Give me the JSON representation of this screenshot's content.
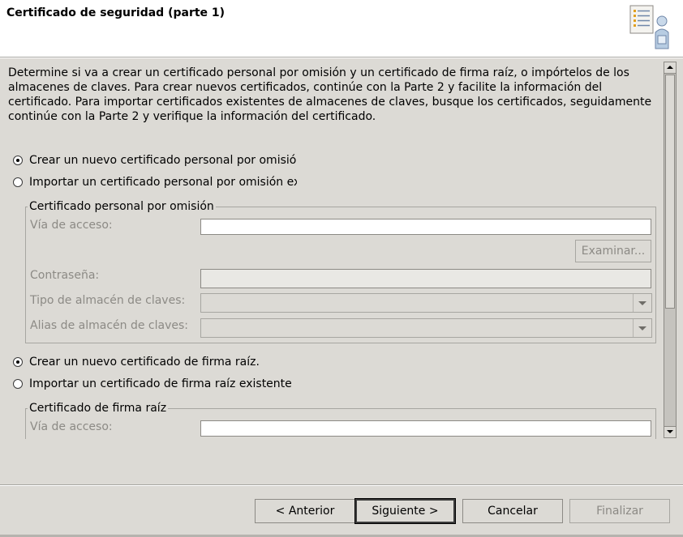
{
  "header": {
    "title": "Certificado de seguridad (parte 1)"
  },
  "intro": "Determine si va a crear un certificado personal por omisión y un certificado de firma raíz, o impórtelos de los almacenes de claves. Para crear nuevos certificados, continúe con la Parte 2 y facilite la información del certificado. Para importar certificados existentes de almacenes de claves, busque los certificados, seguidamente continúe con la Parte 2 y verifique la información del certificado.",
  "personal": {
    "create_label": "Crear un nuevo certificado personal por omisión",
    "import_label": "Importar un certificado personal por omisión existente",
    "selected": "create",
    "group_title": "Certificado personal por omisión",
    "path_label": "Vía de acceso:",
    "path_value": "",
    "browse_label": "Examinar...",
    "password_label": "Contraseña:",
    "keystore_type_label": "Tipo de almacén de claves:",
    "keystore_alias_label": "Alias de almacén de claves:"
  },
  "root": {
    "create_label": "Crear un nuevo certificado de firma raíz.",
    "import_label": "Importar un certificado de firma raíz existente",
    "selected": "create",
    "group_title": "Certificado de firma raíz",
    "path_label": "Vía de acceso:",
    "path_value": ""
  },
  "buttons": {
    "back": "< Anterior",
    "next": "Siguiente >",
    "cancel": "Cancelar",
    "finish": "Finalizar"
  },
  "icons": {
    "header": "certificate-person-icon"
  }
}
